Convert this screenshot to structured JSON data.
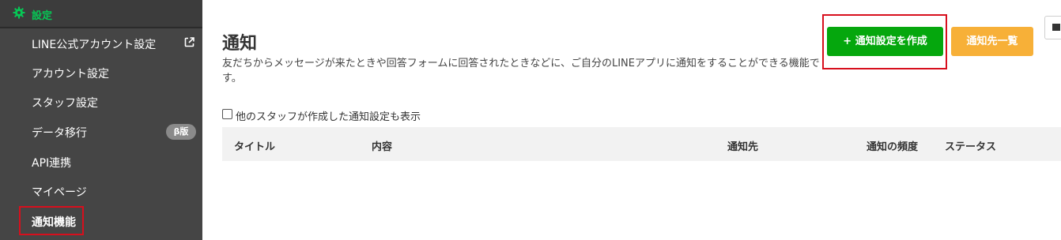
{
  "sidebar": {
    "section_title": "設定",
    "items": [
      {
        "label": "LINE公式アカウント設定",
        "external": true
      },
      {
        "label": "アカウント設定"
      },
      {
        "label": "スタッフ設定"
      },
      {
        "label": "データ移行",
        "badge": "β版"
      },
      {
        "label": "API連携"
      },
      {
        "label": "マイページ"
      },
      {
        "label": "通知機能",
        "active": true
      }
    ]
  },
  "main": {
    "title": "通知",
    "description": "友だちからメッセージが来たときや回答フォームに回答されたときなどに、ご自分のLINEアプリに通知をすることができる機能です。",
    "buttons": {
      "create": "+ 通知設定を作成",
      "destinations": "通知先一覧"
    },
    "checkbox_label": "他のスタッフが作成した通知設定も表示",
    "table": {
      "columns": [
        "タイトル",
        "内容",
        "通知先",
        "通知の頻度",
        "ステータス"
      ]
    }
  },
  "colors": {
    "brand_green": "#06c755",
    "create_button": "#05a70d",
    "dest_button": "#f7b038",
    "highlight": "#d70f1d",
    "sidebar_bg": "#454545"
  }
}
